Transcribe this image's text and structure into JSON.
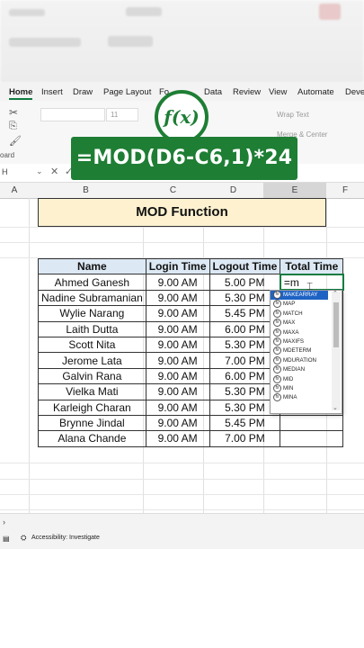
{
  "ribbon": {
    "tabs": [
      "Home",
      "Insert",
      "Draw",
      "Page Layout",
      "Fo",
      "Data",
      "Review",
      "View",
      "Automate",
      "Devel"
    ],
    "font_size": "11",
    "wrap_text": "Wrap Text",
    "merge_center": "Merge & Center",
    "clipboard_label": "oard"
  },
  "formula_bar": {
    "name_box": "H"
  },
  "overlay": {
    "fx_label": "f(x)",
    "formula": "=MOD(D6-C6,1)*24"
  },
  "columns": [
    "A",
    "B",
    "C",
    "D",
    "E",
    "F"
  ],
  "sheet": {
    "title": "MOD Function",
    "headers": [
      "Name",
      "Login Time",
      "Logout Time",
      "Total Time"
    ],
    "rows": [
      [
        "Ahmed Ganesh",
        "9.00 AM",
        "5.00 PM",
        "=m"
      ],
      [
        "Nadine Subramanian",
        "9.00 AM",
        "5.30 PM",
        ""
      ],
      [
        "Wylie Narang",
        "9.00 AM",
        "5.45 PM",
        ""
      ],
      [
        "Laith Dutta",
        "9.00 AM",
        "6.00 PM",
        ""
      ],
      [
        "Scott Nita",
        "9.00 AM",
        "5.30 PM",
        ""
      ],
      [
        "Jerome Lata",
        "9.00 AM",
        "7.00 PM",
        ""
      ],
      [
        "Galvin Rana",
        "9.00 AM",
        "6.00 PM",
        ""
      ],
      [
        "Vielka Mati",
        "9.00 AM",
        "5.30 PM",
        ""
      ],
      [
        "Karleigh Charan",
        "9.00 AM",
        "5.30 PM",
        ""
      ],
      [
        "Brynne Jindal",
        "9.00 AM",
        "5.45 PM",
        ""
      ],
      [
        "Alana Chande",
        "9.00 AM",
        "7.00 PM",
        ""
      ]
    ]
  },
  "autocomplete": {
    "items": [
      "MAKEARRAY",
      "MAP",
      "MATCH",
      "MAX",
      "MAXA",
      "MAXIFS",
      "MDETERM",
      "MDURATION",
      "MEDIAN",
      "MID",
      "MIN",
      "MINA"
    ],
    "selected_index": 0
  },
  "status": {
    "accessibility": "Accessibility: Investigate"
  }
}
